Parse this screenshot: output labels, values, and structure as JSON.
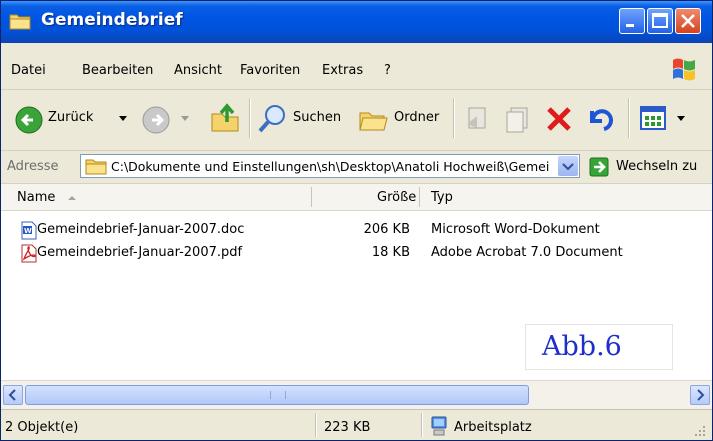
{
  "window": {
    "title": "Gemeindebrief"
  },
  "menubar": {
    "items": [
      "Datei",
      "Bearbeiten",
      "Ansicht",
      "Favoriten",
      "Extras",
      "?"
    ]
  },
  "toolbar": {
    "back_label": "Zurück",
    "search_label": "Suchen",
    "folders_label": "Ordner"
  },
  "address": {
    "label": "Adresse",
    "value": "C:\\Dokumente und Einstellungen\\sh\\Desktop\\Anatoli Hochweiß\\Gemei",
    "go_label": "Wechseln zu"
  },
  "columns": {
    "name": "Name",
    "size": "Größe",
    "type": "Typ"
  },
  "files": [
    {
      "name": "Gemeindebrief-Januar-2007.doc",
      "size": "206 KB",
      "type": "Microsoft Word-Dokument",
      "icon": "word-doc-icon"
    },
    {
      "name": "Gemeindebrief-Januar-2007.pdf",
      "size": "18 KB",
      "type": "Adobe Acrobat 7.0 Document",
      "icon": "pdf-icon"
    }
  ],
  "annotation": "Abb.6",
  "status": {
    "objects": "2 Objekt(e)",
    "size": "223 KB",
    "location": "Arbeitsplatz"
  },
  "colors": {
    "title_bar": "#0054e3",
    "close_button": "#d5431e",
    "annotation_text": "#1f2ec8"
  }
}
